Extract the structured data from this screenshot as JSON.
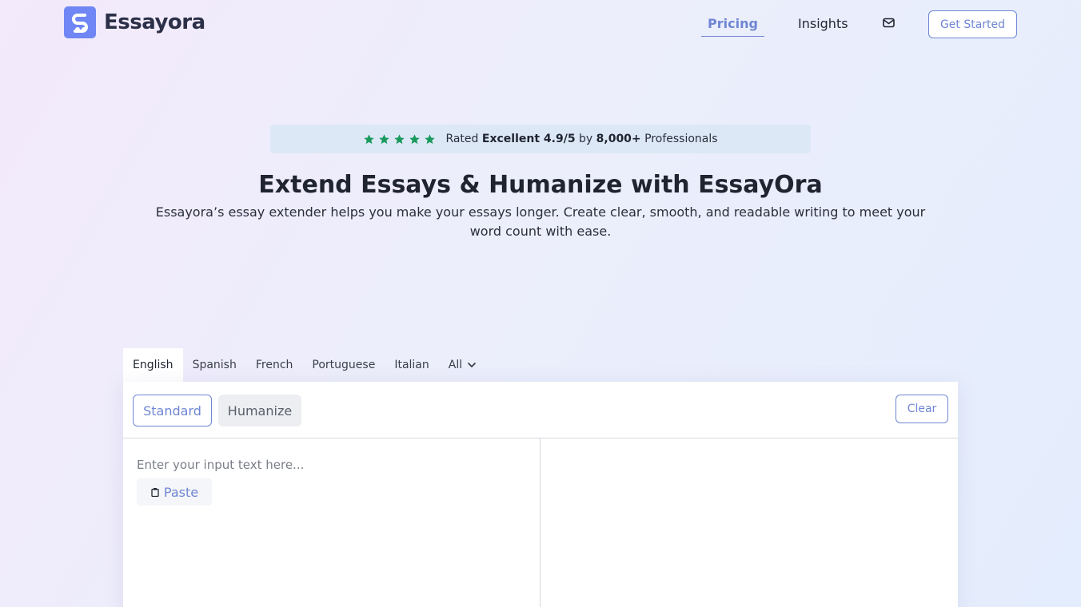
{
  "header": {
    "brand": "Essayora",
    "nav": {
      "pricing": "Pricing",
      "insights": "Insights",
      "mail_icon": "mail-icon"
    },
    "cta": "Get Started"
  },
  "rating": {
    "stars": 5,
    "prefix": "Rated ",
    "excellent": "Excellent 4.9/5",
    "by": " by ",
    "count": "8,000+",
    "suffix": " Professionals",
    "star_color": "#1a9a5c"
  },
  "hero": {
    "title": "Extend Essays & Humanize with EssayOra",
    "subtitle": "Essayora’s essay extender helps you make your essays longer. Create clear, smooth, and readable writing to meet your word count with ease."
  },
  "languages": {
    "tabs": [
      "English",
      "Spanish",
      "French",
      "Portuguese",
      "Italian",
      "All"
    ],
    "active": "English"
  },
  "editor": {
    "modes": {
      "standard": "Standard",
      "humanize": "Humanize"
    },
    "clear": "Clear",
    "input_placeholder": "Enter your input text here...",
    "input_value": "",
    "paste": "Paste"
  },
  "colors": {
    "accent": "#6f86d4",
    "brand_mark": "#6f86f4",
    "rating_bg": "#dde8f6"
  }
}
